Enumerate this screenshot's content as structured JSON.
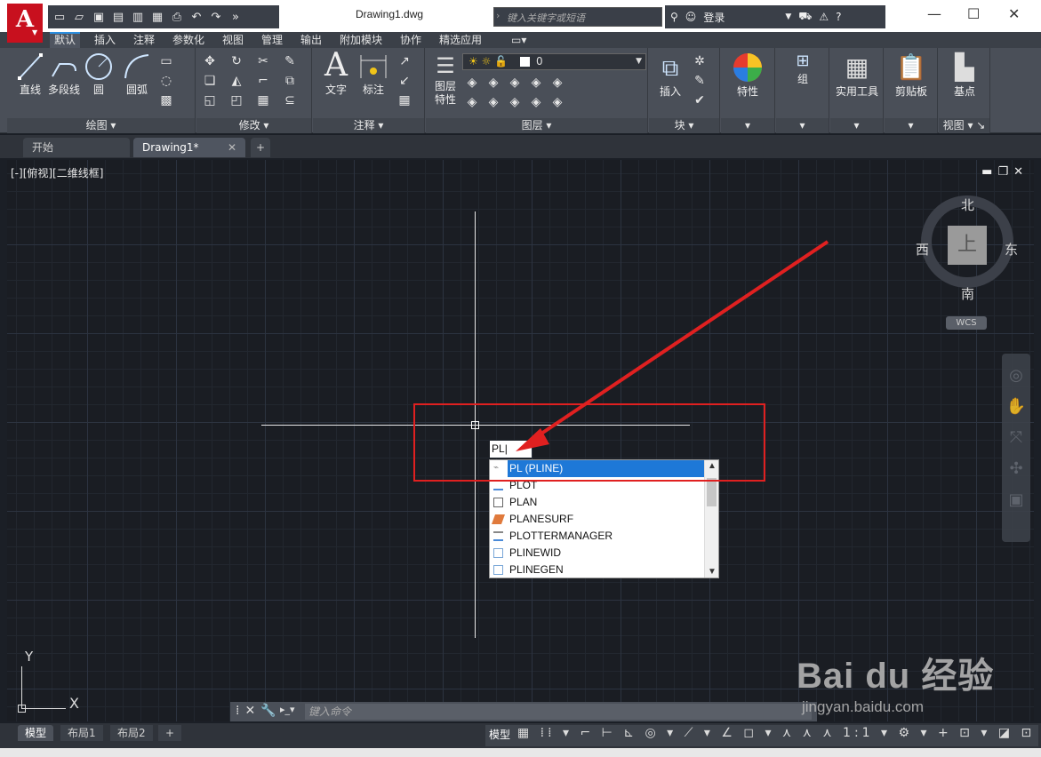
{
  "titlebar": {
    "app_logo": "A",
    "document_title": "Drawing1.dwg",
    "search_placeholder": "键入关键字或短语",
    "login_label": "登录"
  },
  "ribbon_tabs": [
    "默认",
    "插入",
    "注释",
    "参数化",
    "视图",
    "管理",
    "输出",
    "附加模块",
    "协作",
    "精选应用"
  ],
  "ribbon": {
    "draw": {
      "label": "绘图 ▾",
      "tools": [
        "直线",
        "多段线",
        "圆",
        "圆弧"
      ]
    },
    "modify": {
      "label": "修改 ▾"
    },
    "annotation": {
      "label": "注释 ▾",
      "tools": [
        "文字",
        "标注"
      ]
    },
    "layers": {
      "label": "图层 ▾",
      "tool": "图层\n特性",
      "layer_tool_line1": "图层",
      "layer_tool_line2": "特性",
      "current_layer": "0"
    },
    "block": {
      "label": "块 ▾",
      "tool": "插入"
    },
    "properties": {
      "tool": "特性"
    },
    "groups": {
      "tool": "组"
    },
    "utilities": {
      "tool": "实用工具"
    },
    "clipboard": {
      "tool": "剪贴板"
    },
    "view": {
      "label": "视图 ▾",
      "tool": "基点"
    }
  },
  "file_tabs": {
    "start": "开始",
    "drawing": "Drawing1*"
  },
  "viewport": {
    "label": "[-][俯视][二维线框]",
    "command_input": "PL",
    "autocomplete": [
      "PL (PLINE)",
      "PLOT",
      "PLAN",
      "PLANESURF",
      "PLOTTERMANAGER",
      "PLINEWID",
      "PLINEGEN"
    ]
  },
  "viewcube": {
    "north": "北",
    "south": "南",
    "east": "东",
    "west": "西",
    "top": "上",
    "wcs": "WCS"
  },
  "ucs": {
    "x": "X",
    "y": "Y"
  },
  "command_line": {
    "placeholder": "键入命令"
  },
  "status_bar": {
    "layout_tabs": [
      "模型",
      "布局1",
      "布局2"
    ],
    "model_label": "模型",
    "scale": "1:1"
  },
  "watermark": {
    "main": "Bai du 经验",
    "sub": "jingyan.baidu.com"
  },
  "colors": {
    "accent_red": "#e02020",
    "selection_blue": "#1e78d7",
    "logo_red": "#c8101e"
  }
}
